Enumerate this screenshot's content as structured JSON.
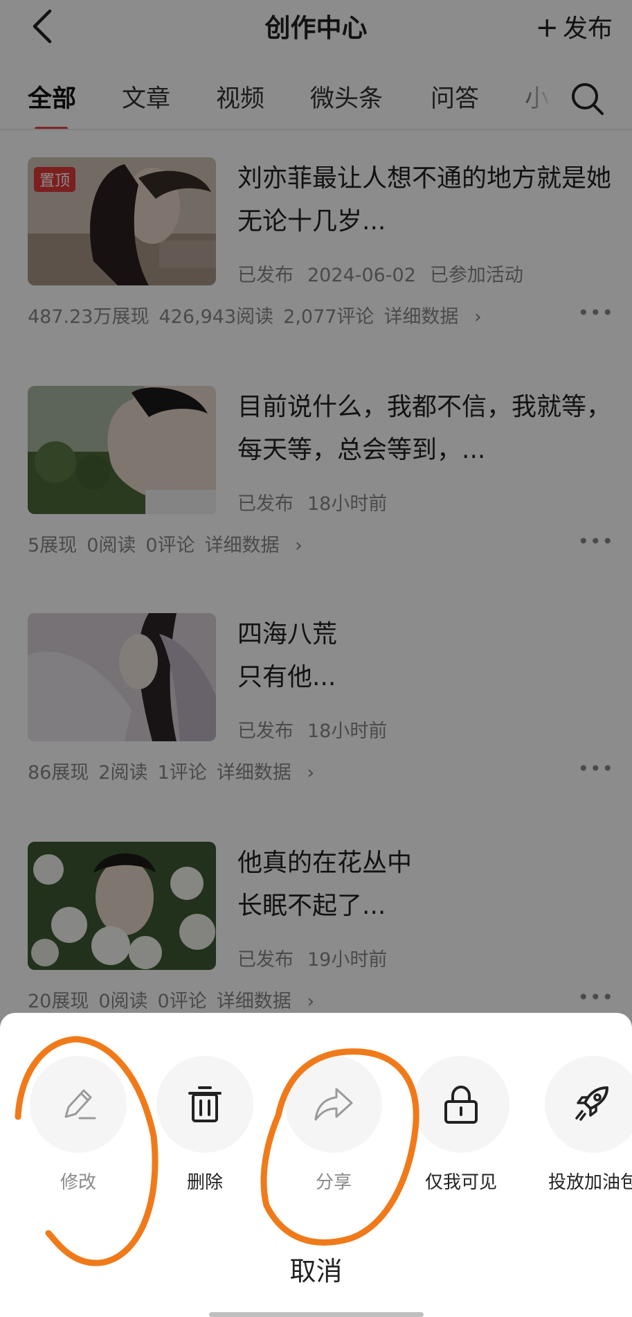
{
  "header": {
    "title": "创作中心",
    "publish_label": "发布"
  },
  "tabs": [
    {
      "label": "全部",
      "active": true
    },
    {
      "label": "文章"
    },
    {
      "label": "视频"
    },
    {
      "label": "微头条"
    },
    {
      "label": "问答"
    },
    {
      "label": "小"
    }
  ],
  "articles": [
    {
      "pinned_badge": "置顶",
      "title": "刘亦菲最让人想不通的地方就是她无论十几岁...",
      "status": "已发布",
      "time": "2024-06-02",
      "extra": "已参加活动",
      "impressions": "487.23万展现",
      "reads": "426,943阅读",
      "comments": "2,077评论",
      "detail_label": "详细数据"
    },
    {
      "title": "目前说什么，我都不信，我就等，每天等，总会等到，...",
      "status": "已发布",
      "time": "18小时前",
      "impressions": "5展现",
      "reads": "0阅读",
      "comments": "0评论",
      "detail_label": "详细数据"
    },
    {
      "title_line1": "四海八荒",
      "title_line2": "只有他...",
      "status": "已发布",
      "time": "18小时前",
      "impressions": "86展现",
      "reads": "2阅读",
      "comments": "1评论",
      "detail_label": "详细数据"
    },
    {
      "title_line1": "他真的在花丛中",
      "title_line2": "长眠不起了...",
      "status": "已发布",
      "time": "19小时前",
      "impressions": "20展现",
      "reads": "0阅读",
      "comments": "0评论",
      "detail_label": "详细数据"
    }
  ],
  "sheet": {
    "actions": [
      {
        "label": "修改",
        "icon": "pencil-icon",
        "enabled": false
      },
      {
        "label": "删除",
        "icon": "trash-icon",
        "enabled": true
      },
      {
        "label": "分享",
        "icon": "share-arrow-icon",
        "enabled": false
      },
      {
        "label": "仅我可见",
        "icon": "lock-icon",
        "enabled": true
      },
      {
        "label": "投放加油包",
        "icon": "rocket-icon",
        "enabled": true
      }
    ],
    "cancel_label": "取消"
  },
  "colors": {
    "accent": "#e64545",
    "annotation": "#f07a1a",
    "overlay": "rgba(0,0,0,0.45)"
  }
}
